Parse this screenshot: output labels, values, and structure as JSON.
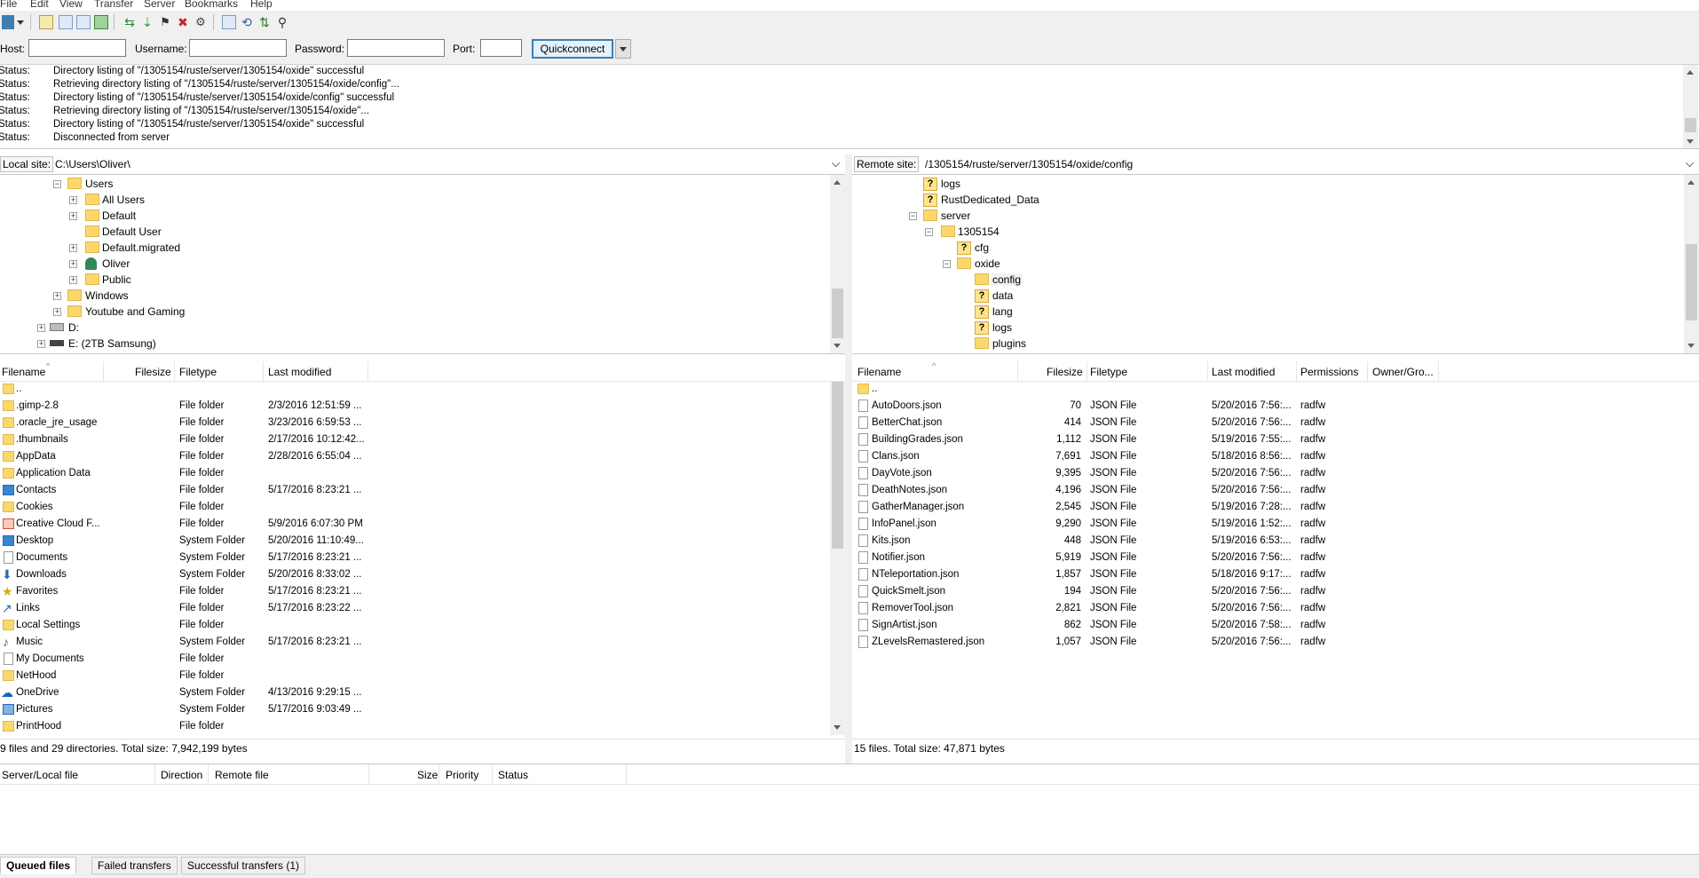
{
  "menu": [
    "File",
    "Edit",
    "View",
    "Transfer",
    "Server",
    "Bookmarks",
    "Help"
  ],
  "quickconnect": {
    "host_label": "Host:",
    "host_value": "",
    "user_label": "Username:",
    "user_value": "",
    "pass_label": "Password:",
    "pass_value": "",
    "port_label": "Port:",
    "port_value": "",
    "button": "Quickconnect"
  },
  "log": [
    {
      "k": "Status:",
      "v": "Directory listing of \"/1305154/ruste/server/1305154/oxide\" successful"
    },
    {
      "k": "Status:",
      "v": "Retrieving directory listing of \"/1305154/ruste/server/1305154/oxide/config\"..."
    },
    {
      "k": "Status:",
      "v": "Directory listing of \"/1305154/ruste/server/1305154/oxide/config\" successful"
    },
    {
      "k": "Status:",
      "v": "Retrieving directory listing of \"/1305154/ruste/server/1305154/oxide\"..."
    },
    {
      "k": "Status:",
      "v": "Directory listing of \"/1305154/ruste/server/1305154/oxide\" successful"
    },
    {
      "k": "Status:",
      "v": "Disconnected from server"
    }
  ],
  "local": {
    "site_label": "Local site:",
    "path": "C:\\Users\\Oliver\\",
    "tree": [
      {
        "label": "Users",
        "expanded": true
      },
      {
        "label": "All Users",
        "expanded": false
      },
      {
        "label": "Default",
        "expanded": false
      },
      {
        "label": "Default User",
        "expanded": null
      },
      {
        "label": "Default.migrated",
        "expanded": false
      },
      {
        "label": "Oliver",
        "expanded": false
      },
      {
        "label": "Public",
        "expanded": false
      },
      {
        "label": "Windows",
        "expanded": false
      },
      {
        "label": "Youtube and Gaming",
        "expanded": false
      },
      {
        "label": "D:",
        "expanded": false
      },
      {
        "label": "E: (2TB Samsung)",
        "expanded": false
      }
    ],
    "headers": [
      "Filename",
      "Filesize",
      "Filetype",
      "Last modified"
    ],
    "files": [
      {
        "name": "..",
        "size": "",
        "type": "",
        "modified": ""
      },
      {
        "name": ".gimp-2.8",
        "size": "",
        "type": "File folder",
        "modified": "2/3/2016 12:51:59 ..."
      },
      {
        "name": ".oracle_jre_usage",
        "size": "",
        "type": "File folder",
        "modified": "3/23/2016 6:59:53 ..."
      },
      {
        "name": ".thumbnails",
        "size": "",
        "type": "File folder",
        "modified": "2/17/2016 10:12:42..."
      },
      {
        "name": "AppData",
        "size": "",
        "type": "File folder",
        "modified": "2/28/2016 6:55:04 ..."
      },
      {
        "name": "Application Data",
        "size": "",
        "type": "File folder",
        "modified": ""
      },
      {
        "name": "Contacts",
        "size": "",
        "type": "File folder",
        "modified": "5/17/2016 8:23:21 ..."
      },
      {
        "name": "Cookies",
        "size": "",
        "type": "File folder",
        "modified": ""
      },
      {
        "name": "Creative Cloud F...",
        "size": "",
        "type": "File folder",
        "modified": "5/9/2016 6:07:30 PM"
      },
      {
        "name": "Desktop",
        "size": "",
        "type": "System Folder",
        "modified": "5/20/2016 11:10:49..."
      },
      {
        "name": "Documents",
        "size": "",
        "type": "System Folder",
        "modified": "5/17/2016 8:23:21 ..."
      },
      {
        "name": "Downloads",
        "size": "",
        "type": "System Folder",
        "modified": "5/20/2016 8:33:02 ..."
      },
      {
        "name": "Favorites",
        "size": "",
        "type": "File folder",
        "modified": "5/17/2016 8:23:21 ..."
      },
      {
        "name": "Links",
        "size": "",
        "type": "File folder",
        "modified": "5/17/2016 8:23:22 ..."
      },
      {
        "name": "Local Settings",
        "size": "",
        "type": "File folder",
        "modified": ""
      },
      {
        "name": "Music",
        "size": "",
        "type": "System Folder",
        "modified": "5/17/2016 8:23:21 ..."
      },
      {
        "name": "My Documents",
        "size": "",
        "type": "File folder",
        "modified": ""
      },
      {
        "name": "NetHood",
        "size": "",
        "type": "File folder",
        "modified": ""
      },
      {
        "name": "OneDrive",
        "size": "",
        "type": "System Folder",
        "modified": "4/13/2016 9:29:15 ..."
      },
      {
        "name": "Pictures",
        "size": "",
        "type": "System Folder",
        "modified": "5/17/2016 9:03:49 ..."
      },
      {
        "name": "PrintHood",
        "size": "",
        "type": "File folder",
        "modified": ""
      }
    ],
    "status": "9 files and 29 directories. Total size: 7,942,199 bytes"
  },
  "remote": {
    "site_label": "Remote site:",
    "path": "/1305154/ruste/server/1305154/oxide/config",
    "tree": [
      {
        "label": "logs",
        "type": "q"
      },
      {
        "label": "RustDedicated_Data",
        "type": "q"
      },
      {
        "label": "server",
        "type": "f"
      },
      {
        "label": "1305154",
        "type": "f"
      },
      {
        "label": "cfg",
        "type": "q"
      },
      {
        "label": "oxide",
        "type": "f"
      },
      {
        "label": "config",
        "type": "f"
      },
      {
        "label": "data",
        "type": "q"
      },
      {
        "label": "lang",
        "type": "q"
      },
      {
        "label": "logs",
        "type": "q"
      },
      {
        "label": "plugins",
        "type": "f"
      }
    ],
    "headers": [
      "Filename",
      "Filesize",
      "Filetype",
      "Last modified",
      "Permissions",
      "Owner/Gro..."
    ],
    "files": [
      {
        "name": "..",
        "size": "",
        "type": "",
        "modified": "",
        "perm": ""
      },
      {
        "name": "AutoDoors.json",
        "size": "70",
        "type": "JSON File",
        "modified": "5/20/2016 7:56:...",
        "perm": "radfw"
      },
      {
        "name": "BetterChat.json",
        "size": "414",
        "type": "JSON File",
        "modified": "5/20/2016 7:56:...",
        "perm": "radfw"
      },
      {
        "name": "BuildingGrades.json",
        "size": "1,112",
        "type": "JSON File",
        "modified": "5/19/2016 7:55:...",
        "perm": "radfw"
      },
      {
        "name": "Clans.json",
        "size": "7,691",
        "type": "JSON File",
        "modified": "5/18/2016 8:56:...",
        "perm": "radfw"
      },
      {
        "name": "DayVote.json",
        "size": "9,395",
        "type": "JSON File",
        "modified": "5/20/2016 7:56:...",
        "perm": "radfw"
      },
      {
        "name": "DeathNotes.json",
        "size": "4,196",
        "type": "JSON File",
        "modified": "5/20/2016 7:56:...",
        "perm": "radfw"
      },
      {
        "name": "GatherManager.json",
        "size": "2,545",
        "type": "JSON File",
        "modified": "5/19/2016 7:28:...",
        "perm": "radfw"
      },
      {
        "name": "InfoPanel.json",
        "size": "9,290",
        "type": "JSON File",
        "modified": "5/19/2016 1:52:...",
        "perm": "radfw"
      },
      {
        "name": "Kits.json",
        "size": "448",
        "type": "JSON File",
        "modified": "5/19/2016 6:53:...",
        "perm": "radfw"
      },
      {
        "name": "Notifier.json",
        "size": "5,919",
        "type": "JSON File",
        "modified": "5/20/2016 7:56:...",
        "perm": "radfw"
      },
      {
        "name": "NTeleportation.json",
        "size": "1,857",
        "type": "JSON File",
        "modified": "5/18/2016 9:17:...",
        "perm": "radfw"
      },
      {
        "name": "QuickSmelt.json",
        "size": "194",
        "type": "JSON File",
        "modified": "5/20/2016 7:56:...",
        "perm": "radfw"
      },
      {
        "name": "RemoverTool.json",
        "size": "2,821",
        "type": "JSON File",
        "modified": "5/20/2016 7:56:...",
        "perm": "radfw"
      },
      {
        "name": "SignArtist.json",
        "size": "862",
        "type": "JSON File",
        "modified": "5/20/2016 7:58:...",
        "perm": "radfw"
      },
      {
        "name": "ZLevelsRemastered.json",
        "size": "1,057",
        "type": "JSON File",
        "modified": "5/20/2016 7:56:...",
        "perm": "radfw"
      }
    ],
    "status": "15 files. Total size: 47,871 bytes"
  },
  "queue": {
    "headers": [
      "Server/Local file",
      "Direction",
      "Remote file",
      "Size",
      "Priority",
      "Status"
    ]
  },
  "tabs": [
    "Queued files",
    "Failed transfers",
    "Successful transfers (1)"
  ],
  "colors": {
    "folder": "#fbd86c",
    "accent": "#3c7fb1",
    "panel": "#f0f0f0"
  }
}
